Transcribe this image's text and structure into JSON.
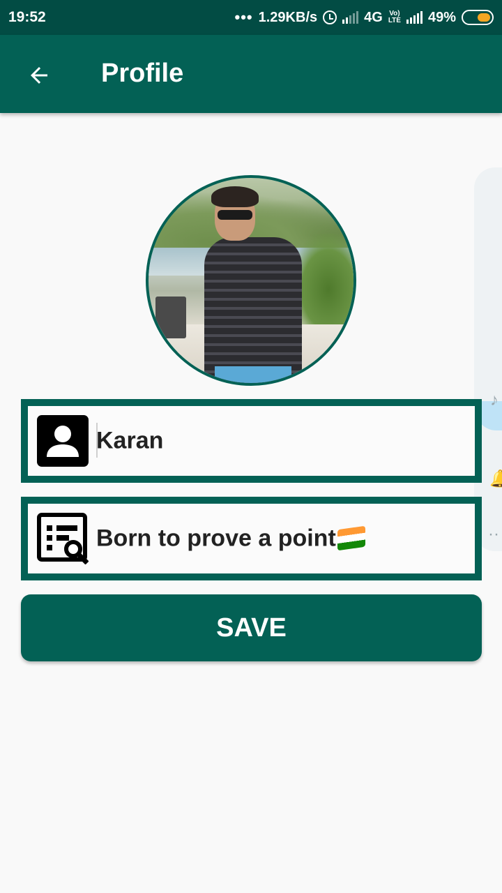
{
  "status_bar": {
    "time": "19:52",
    "dots": "•••",
    "speed": "1.29KB/s",
    "network": "4G",
    "volte": "Vo)",
    "lte": "LTE",
    "battery": "49%"
  },
  "app_bar": {
    "title": "Profile"
  },
  "profile": {
    "name": "Karan",
    "about": "Born to prove a point"
  },
  "save_label": "SAVE",
  "colors": {
    "primary": "#036155",
    "status_bar": "#024c44",
    "background": "#f9f9f9",
    "battery_accent": "#f5a623"
  }
}
